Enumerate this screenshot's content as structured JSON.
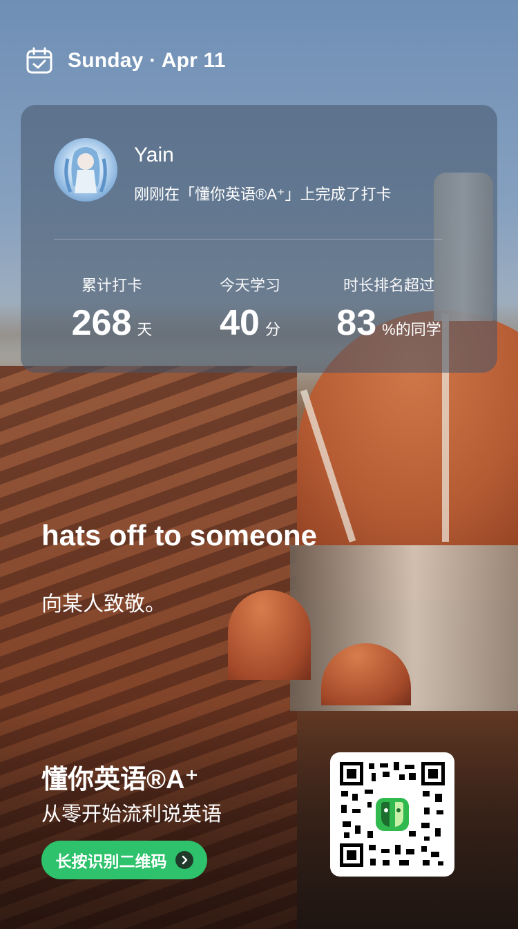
{
  "header": {
    "date": "Sunday · Apr 11",
    "icon": "calendar-check-icon"
  },
  "card": {
    "username": "Yain",
    "status_text": "刚刚在「懂你英语®A⁺」上完成了打卡",
    "stats": [
      {
        "label": "累计打卡",
        "value": "268",
        "unit": "天"
      },
      {
        "label": "今天学习",
        "value": "40",
        "unit": "分"
      },
      {
        "label": "时长排名超过",
        "value": "83",
        "unit": "%的同学"
      }
    ]
  },
  "phrase": {
    "english": "hats off to someone",
    "chinese": "向某人致敬。"
  },
  "footer": {
    "brand": "懂你英语®A⁺",
    "slogan": "从零开始流利说英语",
    "cta_label": "长按识别二维码"
  },
  "colors": {
    "cta": "#2dc26b",
    "card_bg": "rgba(70,85,105,0.55)",
    "logo_green": "#30b94e"
  }
}
